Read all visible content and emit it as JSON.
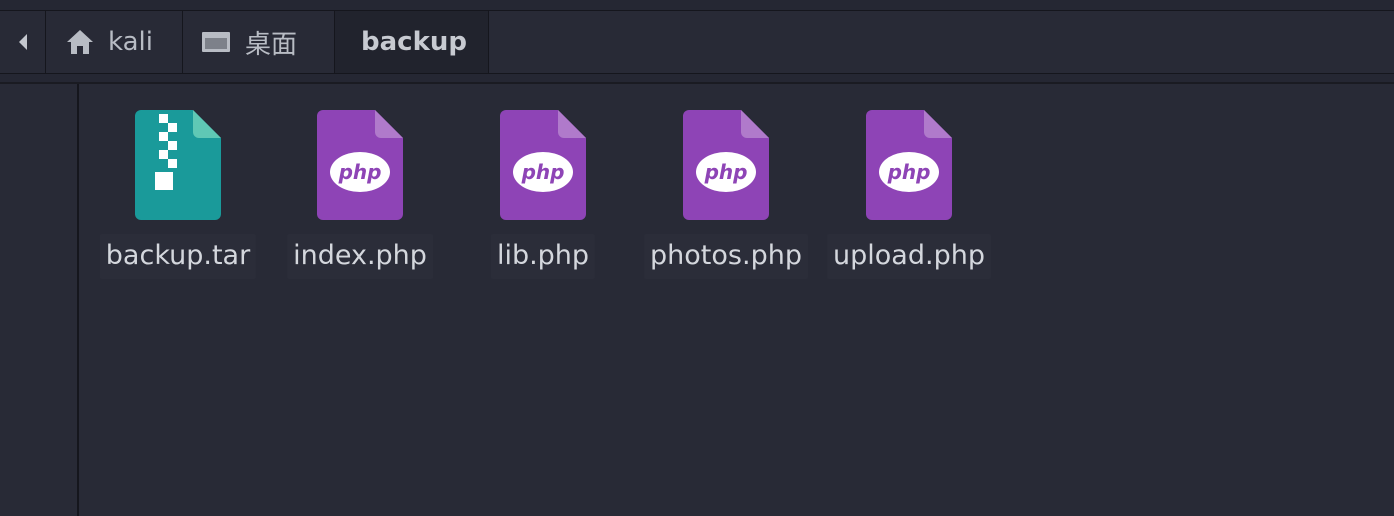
{
  "breadcrumb": {
    "back_icon": "chevron-left-icon",
    "items": [
      {
        "label": "kali",
        "icon": "home-icon"
      },
      {
        "label": "桌面",
        "icon": "desktop-icon"
      },
      {
        "label": "backup",
        "icon": ""
      }
    ]
  },
  "files": [
    {
      "name": "backup.tar",
      "icon": "archive-icon",
      "color": "#1a9a9a"
    },
    {
      "name": "index.php",
      "icon": "php-file-icon",
      "color": "#8e44b6"
    },
    {
      "name": "lib.php",
      "icon": "php-file-icon",
      "color": "#8e44b6"
    },
    {
      "name": "photos.php",
      "icon": "php-file-icon",
      "color": "#8e44b6"
    },
    {
      "name": "upload.php",
      "icon": "php-file-icon",
      "color": "#8e44b6"
    }
  ],
  "icon_text": {
    "php": "php"
  },
  "colors": {
    "background": "#282a36",
    "php_file": "#8e44b6",
    "php_fold": "#b07acb",
    "archive_file": "#1a9a9a",
    "archive_fold": "#5fc8b5"
  }
}
